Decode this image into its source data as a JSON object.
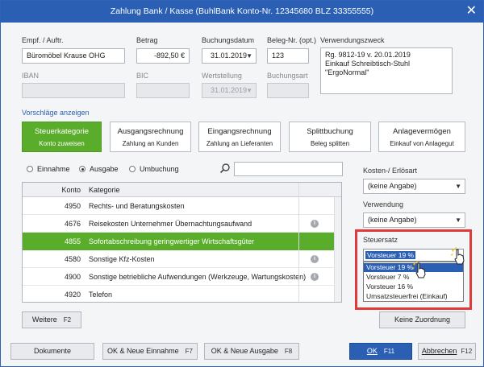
{
  "window": {
    "title": "Zahlung Bank / Kasse (BuhlBank Konto-Nr. 12345680  BLZ 33355555)",
    "close": "✕"
  },
  "form": {
    "empf_label": "Empf. / Auftr.",
    "empf_value": "Büromöbel Krause OHG",
    "betrag_label": "Betrag",
    "betrag_value": "-892,50 €",
    "buchungsdatum_label": "Buchungsdatum",
    "buchungsdatum_value": "31.01.2019",
    "beleg_label": "Beleg-Nr. (opt.)",
    "beleg_value": "123",
    "zweck_label": "Verwendungszweck",
    "zweck_lines": [
      "Rg. 9812-19 v. 20.01.2019",
      "Einkauf Schreibtisch-Stuhl",
      "\"ErgoNormal\""
    ],
    "iban_label": "IBAN",
    "bic_label": "BIC",
    "wertstellung_label": "Wertstellung",
    "wertstellung_value": "31.01.2019",
    "buchungsart_label": "Buchungsart"
  },
  "suggestions_link": "Vorschläge anzeigen",
  "tiles": [
    {
      "title": "Steuerkategorie",
      "sub": "Konto zuweisen",
      "active": true
    },
    {
      "title": "Ausgangsrechnung",
      "sub": "Zahlung an Kunden",
      "active": false
    },
    {
      "title": "Eingangsrechnung",
      "sub": "Zahlung an Lieferanten",
      "active": false
    },
    {
      "title": "Splittbuchung",
      "sub": "Beleg splitten",
      "active": false
    },
    {
      "title": "Anlagevermögen",
      "sub": "Einkauf von Anlagegut",
      "active": false
    }
  ],
  "radios": [
    {
      "label": "Einnahme",
      "checked": false
    },
    {
      "label": "Ausgabe",
      "checked": true
    },
    {
      "label": "Umbuchung",
      "checked": false
    }
  ],
  "table": {
    "headers": {
      "konto": "Konto",
      "kategorie": "Kategorie"
    },
    "rows": [
      {
        "konto": "4950",
        "kategorie": "Rechts- und Beratungskosten",
        "info": false,
        "selected": false
      },
      {
        "konto": "4676",
        "kategorie": "Reisekosten Unternehmer Übernachtungsaufwand",
        "info": true,
        "selected": false
      },
      {
        "konto": "4855",
        "kategorie": "Sofortabschreibung geringwertiger Wirtschaftsgüter",
        "info": false,
        "selected": true
      },
      {
        "konto": "4580",
        "kategorie": "Sonstige Kfz-Kosten",
        "info": true,
        "selected": false
      },
      {
        "konto": "4900",
        "kategorie": "Sonstige betriebliche Aufwendungen (Werkzeuge, Wartungskosten)",
        "info": true,
        "selected": false
      },
      {
        "konto": "4920",
        "kategorie": "Telefon",
        "info": false,
        "selected": false
      }
    ]
  },
  "side": {
    "kosten_label": "Kosten-/ Erlösart",
    "kosten_value": "(keine Angabe)",
    "verwendung_label": "Verwendung",
    "verwendung_value": "(keine Angabe)",
    "steuersatz_label": "Steuersatz",
    "steuersatz_value": "Vorsteuer 19 %",
    "steuersatz_options": [
      "Vorsteuer 19 %",
      "Vorsteuer 7 %",
      "Vorsteuer 16 %",
      "Umsatzsteuerfrei (Einkauf)"
    ]
  },
  "buttons": {
    "weitere": "Weitere",
    "weitere_key": "F2",
    "keine_zuordnung": "Keine Zuordnung",
    "dokumente": "Dokumente",
    "ok_einnahme": "OK & Neue Einnahme",
    "ok_einnahme_key": "F7",
    "ok_ausgabe": "OK & Neue Ausgabe",
    "ok_ausgabe_key": "F8",
    "ok": "OK",
    "ok_key": "F11",
    "abbrechen": "Abbrechen",
    "abbrechen_key": "F12"
  },
  "colors": {
    "accent": "#2b5fb4",
    "active_green": "#5aad2a",
    "highlight_red": "#e23a3a"
  }
}
